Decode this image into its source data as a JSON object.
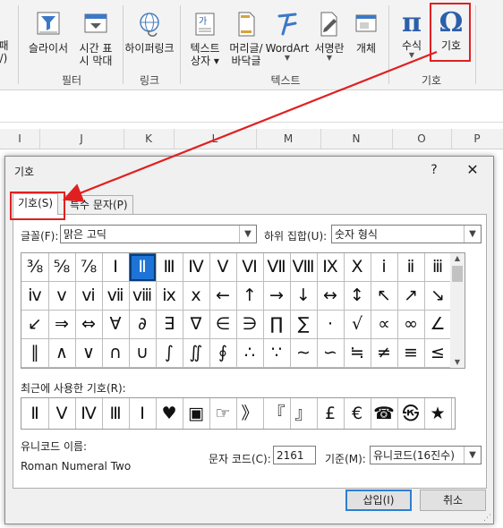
{
  "ribbon": {
    "buttons": [
      {
        "label_lines": [
          "패",
          "/)"
        ]
      },
      {
        "label_lines": [
          "슬라이서"
        ]
      },
      {
        "label_lines": [
          "시간 표",
          "시 막대"
        ]
      },
      {
        "label_lines": [
          "하이퍼링크"
        ]
      },
      {
        "label_lines": [
          "텍스트",
          "상자 ▾"
        ]
      },
      {
        "label_lines": [
          "머리글/",
          "바닥글"
        ]
      },
      {
        "label_lines": [
          "WordArt",
          "▾"
        ]
      },
      {
        "label_lines": [
          "서명란",
          "▾"
        ]
      },
      {
        "label_lines": [
          "개체"
        ]
      },
      {
        "label_lines": [
          "수식",
          "▾"
        ]
      },
      {
        "label_lines": [
          "기호"
        ]
      }
    ],
    "groups": [
      "필터",
      "링크",
      "텍스트",
      "기호"
    ],
    "colors": {
      "accent_red": "#e02020"
    }
  },
  "sheet": {
    "columns": [
      "I",
      "J",
      "K",
      "L",
      "M",
      "N",
      "O",
      "P"
    ]
  },
  "dialog": {
    "title": "기호",
    "help": "?",
    "close": "✕",
    "tabs": [
      "기호(S)",
      "특수 문자(P)"
    ],
    "font_label": "글꼴(F):",
    "font_value": "맑은 고딕",
    "subset_label": "하위 집합(U):",
    "subset_value": "숫자 형식",
    "symbols": [
      [
        "⅜",
        "⅝",
        "⅞",
        "Ⅰ",
        "Ⅱ",
        "Ⅲ",
        "Ⅳ",
        "Ⅴ",
        "Ⅵ",
        "Ⅶ",
        "Ⅷ",
        "Ⅸ",
        "Ⅹ",
        "ⅰ",
        "ⅱ",
        "ⅲ"
      ],
      [
        "ⅳ",
        "ⅴ",
        "ⅵ",
        "ⅶ",
        "ⅷ",
        "ⅸ",
        "ⅹ",
        "←",
        "↑",
        "→",
        "↓",
        "↔",
        "↕",
        "↖",
        "↗",
        "↘"
      ],
      [
        "↙",
        "⇒",
        "⇔",
        "∀",
        "∂",
        "∃",
        "∇",
        "∈",
        "∋",
        "∏",
        "∑",
        "·",
        "√",
        "∝",
        "∞",
        "∠"
      ],
      [
        "∥",
        "∧",
        "∨",
        "∩",
        "∪",
        "∫",
        "∬",
        "∮",
        "∴",
        "∵",
        "∼",
        "∽",
        "≒",
        "≠",
        "≡",
        "≤"
      ]
    ],
    "selected_symbol": "Ⅱ",
    "recent_label": "최근에 사용한 기호(R):",
    "recent": [
      "Ⅱ",
      "Ⅴ",
      "Ⅳ",
      "Ⅲ",
      "Ⅰ",
      "♥",
      "▣",
      "☞",
      "》",
      "『",
      "』",
      "£",
      "€",
      "☎",
      "㉿",
      "★"
    ],
    "unicode_name_label": "유니코드 이름:",
    "unicode_name": "Roman Numeral Two",
    "char_code_label": "문자 코드(C):",
    "char_code": "2161",
    "from_label": "기준(M):",
    "from_value": "유니코드(16진수)",
    "insert_label": "삽입(I)",
    "cancel_label": "취소"
  }
}
